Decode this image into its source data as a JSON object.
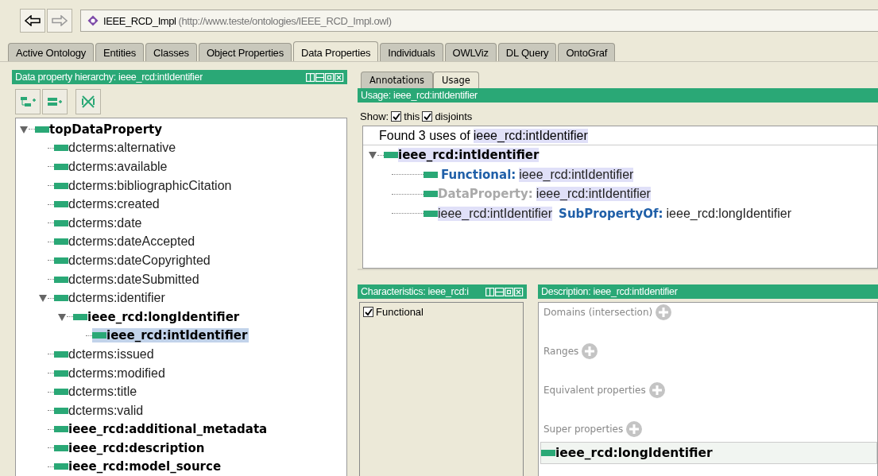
{
  "nav": {
    "back_enabled": true,
    "forward_enabled": false,
    "ontology_name": "IEEE_RCD_Impl",
    "ontology_iri": "(http://www.teste/ontologies/IEEE_RCD_Impl.owl)"
  },
  "tabs": [
    {
      "label": "Active Ontology",
      "selected": false
    },
    {
      "label": "Entities",
      "selected": false
    },
    {
      "label": "Classes",
      "selected": false
    },
    {
      "label": "Object Properties",
      "selected": false
    },
    {
      "label": "Data Properties",
      "selected": true
    },
    {
      "label": "Individuals",
      "selected": false
    },
    {
      "label": "OWLViz",
      "selected": false
    },
    {
      "label": "DL Query",
      "selected": false
    },
    {
      "label": "OntoGraf",
      "selected": false
    }
  ],
  "hierarchy": {
    "title": "Data property hierarchy: ieee_rcd:intIdentifier",
    "items": [
      {
        "label": "topDataProperty",
        "bold": true,
        "selected": false,
        "expanded": true,
        "children": [
          {
            "label": "dcterms:alternative",
            "bold": false,
            "selected": false
          },
          {
            "label": "dcterms:available",
            "bold": false,
            "selected": false
          },
          {
            "label": "dcterms:bibliographicCitation",
            "bold": false,
            "selected": false
          },
          {
            "label": "dcterms:created",
            "bold": false,
            "selected": false
          },
          {
            "label": "dcterms:date",
            "bold": false,
            "selected": false
          },
          {
            "label": "dcterms:dateAccepted",
            "bold": false,
            "selected": false
          },
          {
            "label": "dcterms:dateCopyrighted",
            "bold": false,
            "selected": false
          },
          {
            "label": "dcterms:dateSubmitted",
            "bold": false,
            "selected": false
          },
          {
            "label": "dcterms:identifier",
            "bold": false,
            "selected": false,
            "expanded": true,
            "children": [
              {
                "label": "ieee_rcd:longIdentifier",
                "bold": true,
                "selected": false,
                "expanded": true,
                "children": [
                  {
                    "label": "ieee_rcd:intIdentifier",
                    "bold": true,
                    "selected": true
                  }
                ]
              }
            ]
          },
          {
            "label": "dcterms:issued",
            "bold": false,
            "selected": false
          },
          {
            "label": "dcterms:modified",
            "bold": false,
            "selected": false
          },
          {
            "label": "dcterms:title",
            "bold": false,
            "selected": false
          },
          {
            "label": "dcterms:valid",
            "bold": false,
            "selected": false
          },
          {
            "label": "ieee_rcd:additional_metadata",
            "bold": true,
            "selected": false
          },
          {
            "label": "ieee_rcd:description",
            "bold": true,
            "selected": false
          },
          {
            "label": "ieee_rcd:model_source",
            "bold": true,
            "selected": false
          }
        ]
      }
    ]
  },
  "detail_tabs": [
    {
      "label": "Annotations",
      "selected": false
    },
    {
      "label": "Usage",
      "selected": true
    }
  ],
  "usage": {
    "title": "Usage: ieee_rcd:intIdentifier",
    "show_label": "Show:",
    "options": [
      {
        "label": "this",
        "checked": true
      },
      {
        "label": "disjoints",
        "checked": true
      }
    ],
    "found_prefix": "Found 3 uses of",
    "found_entity": "ieee_rcd:intIdentifier",
    "root": "ieee_rcd:intIdentifier",
    "expanded": true,
    "uses": [
      {
        "parts": [
          {
            "text": "Functional:",
            "kind": "keyword"
          },
          {
            "text": "ieee_rcd:intIdentifier",
            "kind": "entity",
            "highlighted": true
          }
        ]
      },
      {
        "parts": [
          {
            "text": "DataProperty:",
            "kind": "inferred"
          },
          {
            "text": "ieee_rcd:intIdentifier",
            "kind": "entity",
            "highlighted": true
          }
        ]
      },
      {
        "parts": [
          {
            "text": "ieee_rcd:intIdentifier",
            "kind": "entity",
            "highlighted": true
          },
          {
            "text": "SubPropertyOf:",
            "kind": "keyword"
          },
          {
            "text": "ieee_rcd:longIdentifier",
            "kind": "entity",
            "highlighted": false
          }
        ]
      }
    ]
  },
  "characteristics": {
    "title": "Characteristics: ieee_rcd:i",
    "items": [
      {
        "label": "Functional",
        "checked": true
      }
    ]
  },
  "description": {
    "title": "Description: ieee_rcd:intIdentifier",
    "sections": [
      {
        "label": "Domains (intersection)"
      },
      {
        "label": "Ranges"
      },
      {
        "label": "Equivalent properties"
      },
      {
        "label": "Super properties",
        "entries": [
          "ieee_rcd:longIdentifier"
        ]
      }
    ]
  }
}
